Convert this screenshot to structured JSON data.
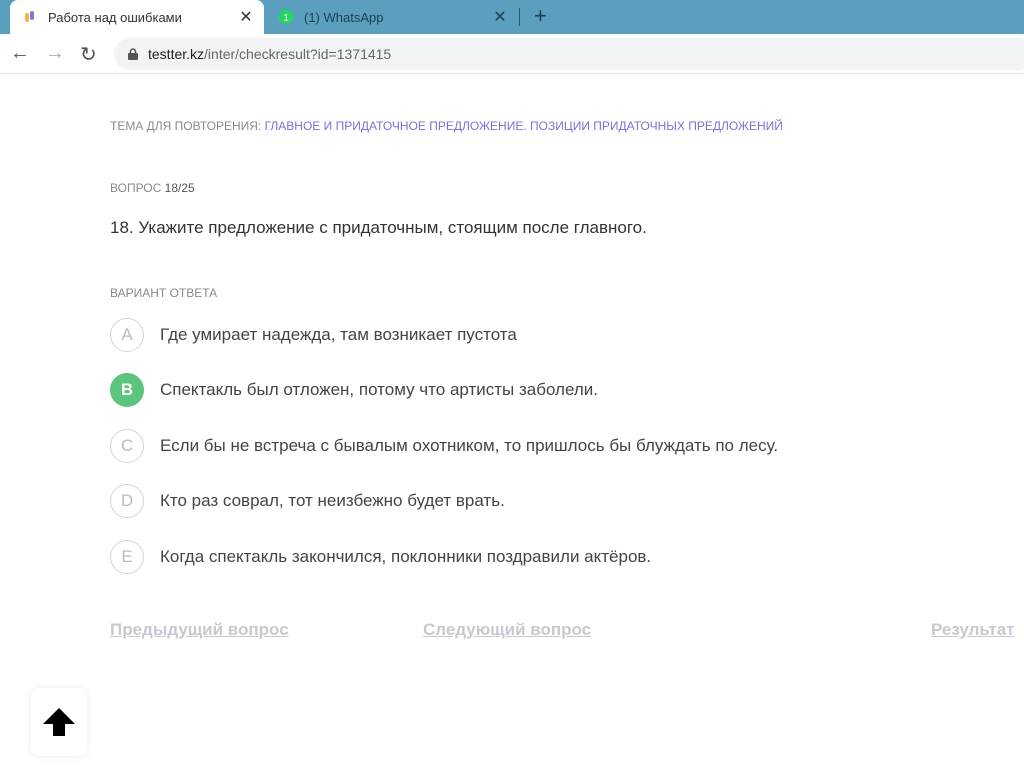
{
  "browser": {
    "tabs": [
      {
        "title": "Работа над ошибками",
        "active": true
      },
      {
        "title": "(1) WhatsApp",
        "badge": "1",
        "active": false
      }
    ],
    "url_host": "testter.kz",
    "url_path": "/inter/checkresult?id=1371415"
  },
  "page": {
    "topic_label": "ТЕМА ДЛЯ ПОВТОРЕНИЯ: ",
    "topic_link": "ГЛАВНОЕ И ПРИДАТОЧНОЕ ПРЕДЛОЖЕНИЕ. ПОЗИЦИИ ПРИДАТОЧНЫХ ПРЕДЛОЖЕНИЙ",
    "question_label": "ВОПРОС ",
    "question_number": "18/25",
    "question_text": "18. Укажите предложение с придаточным, стоящим после главного.",
    "answer_label": "ВАРИАНТ ОТВЕТА",
    "options": [
      {
        "letter": "A",
        "text": "Где умирает надежда, там возникает пустота"
      },
      {
        "letter": "B",
        "text": "Спектакль был отложен, потому что артисты заболели.",
        "selected": true
      },
      {
        "letter": "C",
        "text": "Если бы не встреча с бывалым охотником, то пришлось бы блуждать по лесу."
      },
      {
        "letter": "D",
        "text": "Кто раз соврал, тот неизбежно будет врать."
      },
      {
        "letter": "E",
        "text": "Когда спектакль закончился, поклонники поздравили актёров."
      }
    ],
    "prev": "Предыдущий вопрос",
    "next": "Следующий вопрос",
    "result": "Результат"
  },
  "colors": {
    "selected": "#5cc47c",
    "topic_link": "#7c6fd6",
    "tabbar": "#5a9fbd"
  }
}
